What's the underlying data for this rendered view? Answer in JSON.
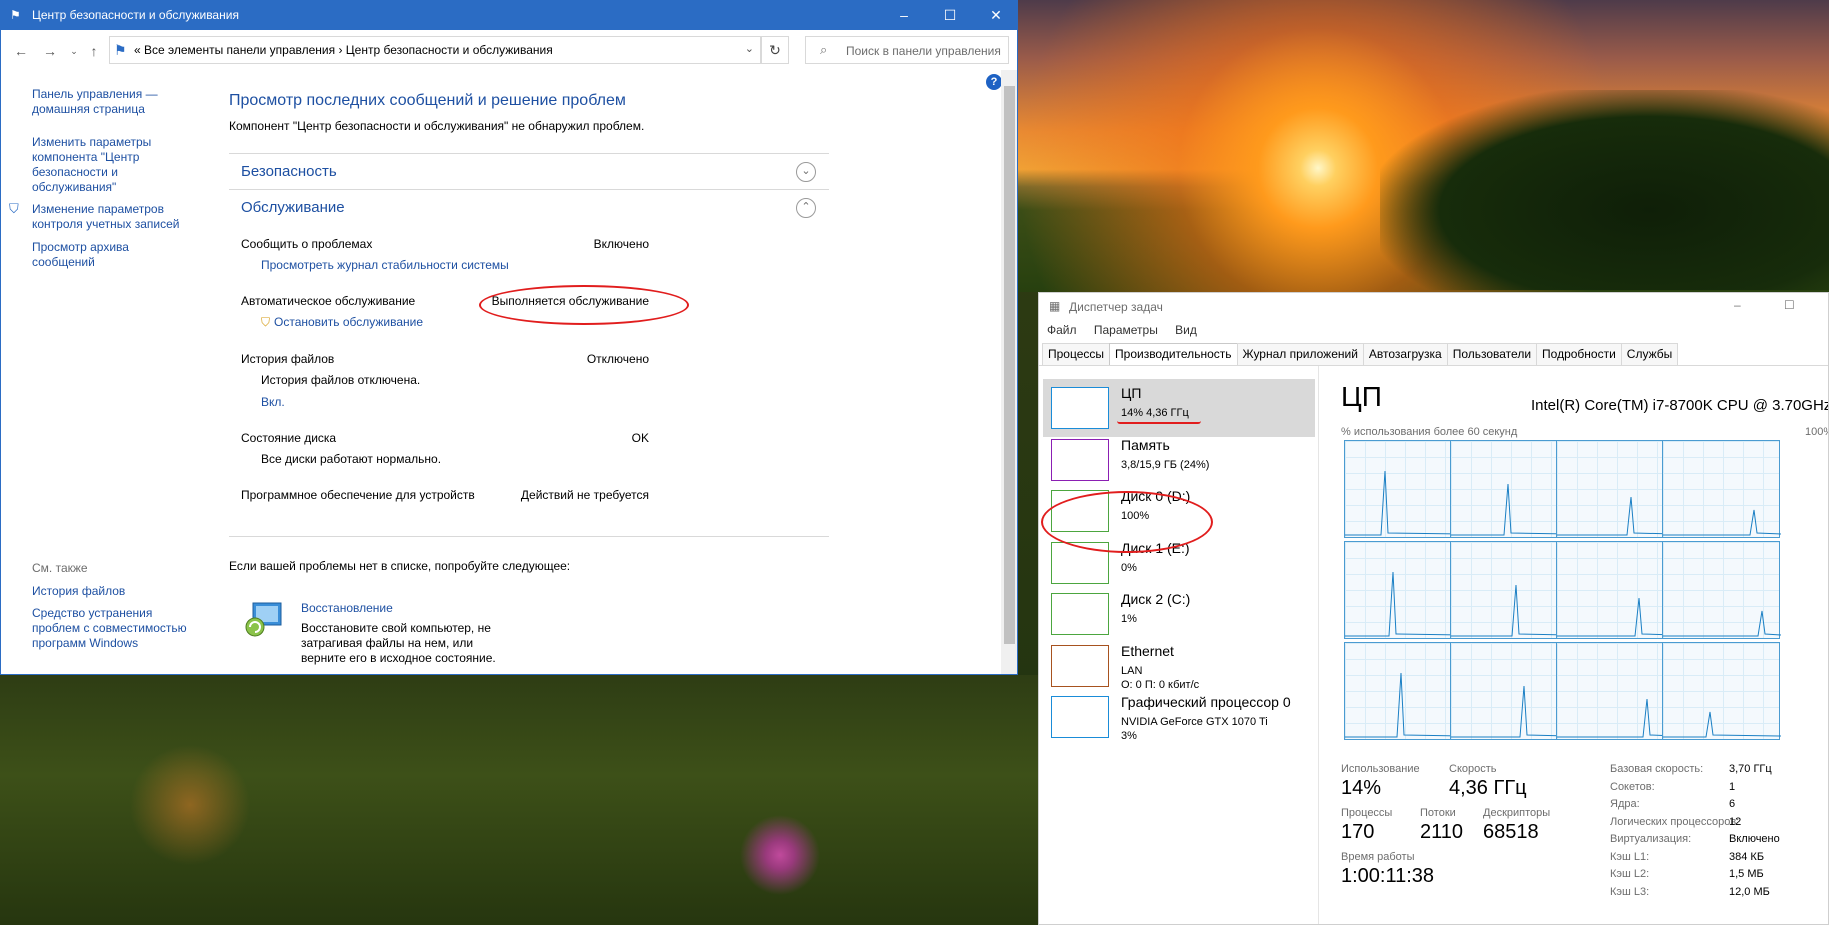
{
  "control_panel": {
    "window_title": "Центр безопасности и обслуживания",
    "address_path": "«   Все элементы панели управления  ›  Центр безопасности и обслуживания",
    "search_placeholder": "Поиск в панели управления",
    "sidebar": {
      "home_link": "Панель управления — домашняя страница",
      "links": [
        "Изменить параметры компонента \"Центр безопасности и обслуживания\"",
        "Изменение параметров контроля учетных записей",
        "Просмотр архива сообщений"
      ],
      "see_also_label": "См. также",
      "see_also_links": [
        "История файлов",
        "Средство устранения проблем с совместимостью программ Windows"
      ]
    },
    "main": {
      "title": "Просмотр последних сообщений и решение проблем",
      "subtitle": "Компонент \"Центр безопасности и обслуживания\" не обнаружил проблем.",
      "section_security": "Безопасность",
      "section_maintenance": "Обслуживание",
      "rows": [
        {
          "label": "Сообщить о проблемах",
          "value": "Включено",
          "link": "Просмотреть журнал стабильности системы"
        },
        {
          "label": "Автоматическое обслуживание",
          "value": "Выполняется обслуживание",
          "link": "Остановить обслуживание"
        },
        {
          "label": "История файлов",
          "value": "Отключено",
          "text": "История файлов отключена.",
          "link": "Вкл."
        },
        {
          "label": "Состояние диска",
          "value": "OK",
          "text": "Все диски работают нормально."
        },
        {
          "label": "Программное обеспечение для устройств",
          "value": "Действий не требуется"
        }
      ],
      "try_text": "Если вашей проблемы нет в списке, попробуйте следующее:",
      "recovery_link": "Восстановление",
      "recovery_desc": "Восстановите свой компьютер, не затрагивая файлы на нем, или верните его в исходное состояние."
    }
  },
  "task_manager": {
    "window_title": "Диспетчер задач",
    "menu": [
      "Файл",
      "Параметры",
      "Вид"
    ],
    "tabs": [
      "Процессы",
      "Производительность",
      "Журнал приложений",
      "Автозагрузка",
      "Пользователи",
      "Подробности",
      "Службы"
    ],
    "active_tab": "Производительность",
    "resources": [
      {
        "name": "ЦП",
        "sub": "14%  4,36 ГГц",
        "color": "#1a8cd8"
      },
      {
        "name": "Память",
        "sub": "3,8/15,9 ГБ (24%)",
        "color": "#8b1fb3"
      },
      {
        "name": "Диск 0 (D:)",
        "sub": "100%",
        "color": "#4ca63f"
      },
      {
        "name": "Диск 1 (E:)",
        "sub": "0%",
        "color": "#4ca63f"
      },
      {
        "name": "Диск 2 (C:)",
        "sub": "1%",
        "color": "#4ca63f"
      },
      {
        "name": "Ethernet",
        "sub": "LAN",
        "sub2": "О: 0 П: 0 кбит/с",
        "color": "#a7521f"
      },
      {
        "name": "Графический процессор 0",
        "sub": "NVIDIA GeForce GTX 1070 Ti",
        "sub2": "3%",
        "color": "#1a8cd8"
      }
    ],
    "cpu": {
      "heading": "ЦП",
      "model": "Intel(R) Core(TM) i7-8700K CPU @ 3.70GHz",
      "graph_caption": "% использования более 60 секунд",
      "graph_max": "100%",
      "usage_label": "Использование",
      "usage": "14%",
      "speed_label": "Скорость",
      "speed": "4,36 ГГц",
      "processes_label": "Процессы",
      "processes": "170",
      "threads_label": "Потоки",
      "threads": "2110",
      "handles_label": "Дескрипторы",
      "handles": "68518",
      "uptime_label": "Время работы",
      "uptime": "1:00:11:38",
      "details": [
        {
          "k": "Базовая скорость:",
          "v": "3,70 ГГц"
        },
        {
          "k": "Сокетов:",
          "v": "1"
        },
        {
          "k": "Ядра:",
          "v": "6"
        },
        {
          "k": "Логических процессоров:",
          "v": "12"
        },
        {
          "k": "Виртуализация:",
          "v": "Включено"
        },
        {
          "k": "Кэш L1:",
          "v": "384 КБ"
        },
        {
          "k": "Кэш L2:",
          "v": "1,5 МБ"
        },
        {
          "k": "Кэш L3:",
          "v": "12,0 МБ"
        }
      ]
    }
  }
}
